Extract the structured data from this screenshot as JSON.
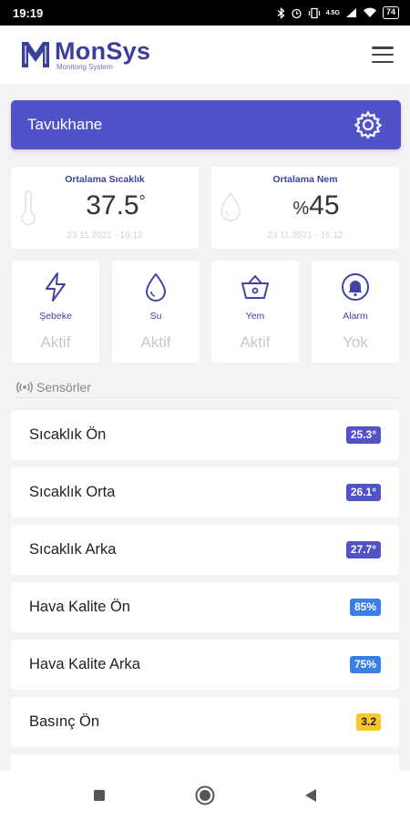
{
  "status_bar": {
    "time": "19:19",
    "network": "4.5G",
    "battery": "74"
  },
  "brand": {
    "name": "MonSys",
    "subtitle": "Monitorig System"
  },
  "farm": {
    "title": "Tavukhane"
  },
  "stats": [
    {
      "label": "Ortalama Sıcaklık",
      "value": "37.5",
      "unit": "°",
      "time": "23.11.2021 - 16:12",
      "icon": "thermometer-icon"
    },
    {
      "label": "Ortalama Nem",
      "prefix": "%",
      "value": "45",
      "time": "23.11.2021 - 16:12",
      "icon": "droplet-icon"
    }
  ],
  "statuses": [
    {
      "label": "Şebeke",
      "value": "Aktif",
      "icon": "lightning-icon"
    },
    {
      "label": "Su",
      "value": "Aktif",
      "icon": "water-drop-icon"
    },
    {
      "label": "Yem",
      "value": "Aktif",
      "icon": "basket-icon"
    },
    {
      "label": "Alarm",
      "value": "Yok",
      "icon": "bell-icon"
    }
  ],
  "sensors_section": {
    "title": "Sensörler",
    "icon": "signal-icon"
  },
  "sensors": [
    {
      "name": "Sıcaklık Ön",
      "value": "25.3°",
      "color": "#5152c7"
    },
    {
      "name": "Sıcaklık Orta",
      "value": "26.1°",
      "color": "#5152c7"
    },
    {
      "name": "Sıcaklık Arka",
      "value": "27.7°",
      "color": "#5152c7"
    },
    {
      "name": "Hava Kalite Ön",
      "value": "85%",
      "color": "#3a7ee8"
    },
    {
      "name": "Hava Kalite Arka",
      "value": "75%",
      "color": "#3a7ee8"
    },
    {
      "name": "Basınç Ön",
      "value": "3.2",
      "color": "#f7c72b"
    }
  ],
  "colors": {
    "primary": "#5152c7",
    "accent_blue": "#3a7ee8",
    "accent_yellow": "#f7c72b"
  }
}
